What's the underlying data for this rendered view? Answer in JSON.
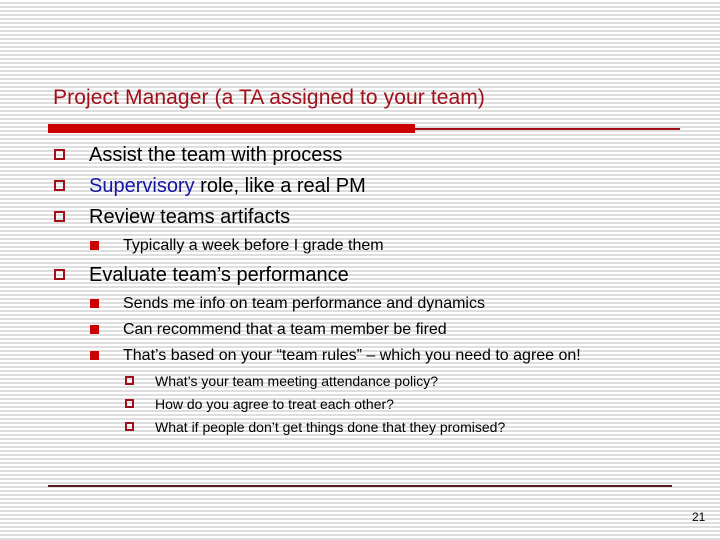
{
  "slide": {
    "title": "Project Manager (a TA assigned to your team)",
    "page_number": "21",
    "colors": {
      "title": "#a10f1a",
      "bar": "#cc0000",
      "accent_text": "#1414a6",
      "bullet": "#cc0000"
    }
  },
  "bullets": {
    "b1": {
      "text": "Assist the team with process"
    },
    "b2": {
      "accent": "Supervisory",
      "text": " role, like a real PM"
    },
    "b3": {
      "text": "Review teams artifacts",
      "sub": {
        "s1": "Typically a week before I grade them"
      }
    },
    "b4": {
      "text": "Evaluate team’s performance",
      "sub": {
        "s1": "Sends me info on team performance and dynamics",
        "s2": "Can recommend that a team member be fired",
        "s3": "That’s based on your “team rules” – which you need to agree on!"
      },
      "subsub": {
        "q1": "What’s your team meeting attendance policy?",
        "q2": "How do you agree to treat each other?",
        "q3": "What if people don’t get things done that they promised?"
      }
    }
  }
}
